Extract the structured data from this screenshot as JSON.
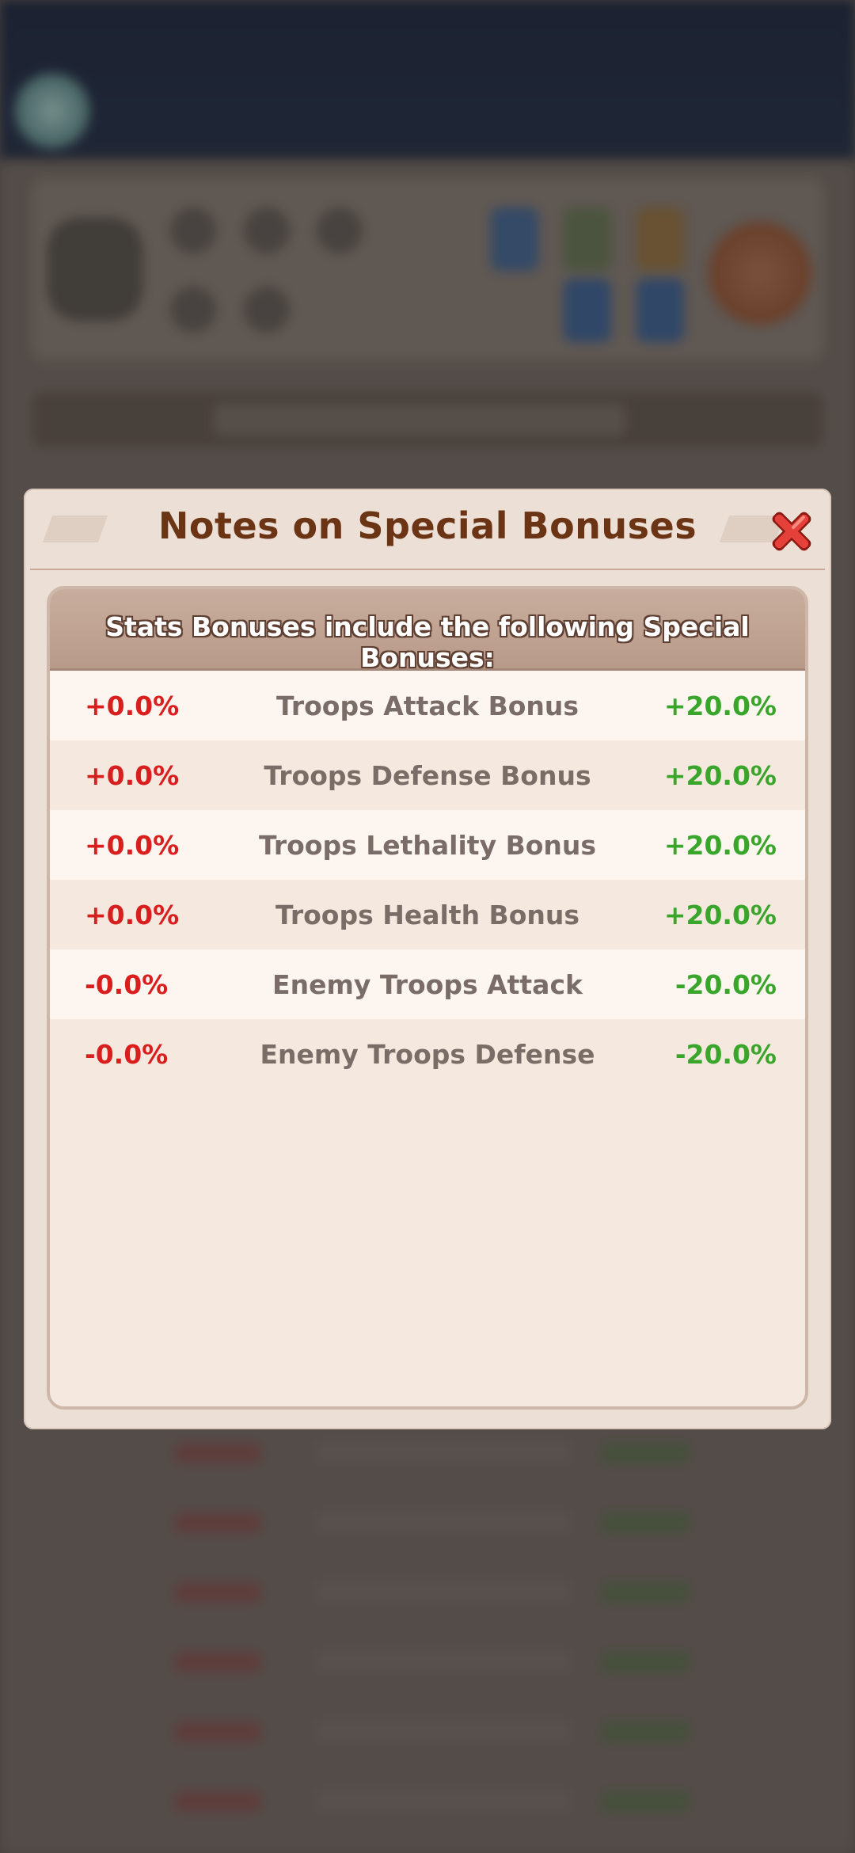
{
  "dialog": {
    "title": "Notes on Special Bonuses",
    "panel_header": "Stats Bonuses include the following Special Bonuses:",
    "close_icon": "close-x-icon",
    "rows": [
      {
        "left": "+0.0%",
        "label": "Troops Attack Bonus",
        "right": "+20.0%"
      },
      {
        "left": "+0.0%",
        "label": "Troops Defense Bonus",
        "right": "+20.0%"
      },
      {
        "left": "+0.0%",
        "label": "Troops Lethality Bonus",
        "right": "+20.0%"
      },
      {
        "left": "+0.0%",
        "label": "Troops Health Bonus",
        "right": "+20.0%"
      },
      {
        "left": "-0.0%",
        "label": "Enemy Troops Attack",
        "right": "-20.0%"
      },
      {
        "left": "-0.0%",
        "label": "Enemy Troops Defense",
        "right": "-20.0%"
      }
    ]
  },
  "colors": {
    "title": "#6b3415",
    "negative_value": "#d91e1e",
    "positive_value": "#3aa52b",
    "label": "#7a6d67"
  }
}
